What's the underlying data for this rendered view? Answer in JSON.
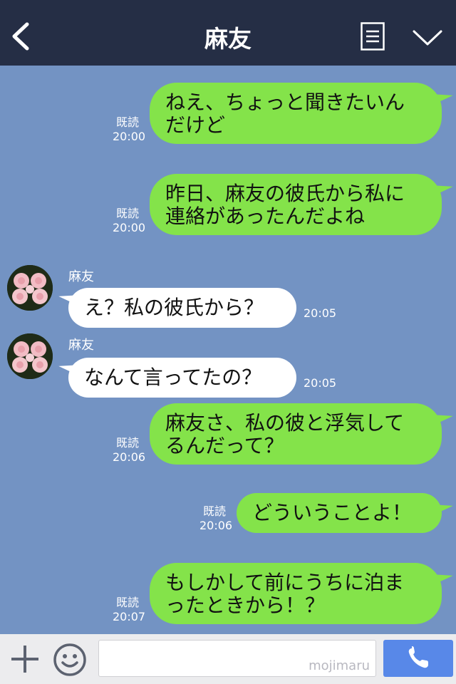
{
  "header": {
    "title": "麻友"
  },
  "chat": {
    "messages": [
      {
        "dir": "out",
        "text": "ねえ、ちょっと聞きたいん\nだけど",
        "read": "既読",
        "time": "20:00"
      },
      {
        "dir": "out",
        "text": "昨日、麻友の彼氏から私に\n連絡があったんだよね",
        "read": "既読",
        "time": "20:00"
      },
      {
        "dir": "in",
        "sender": "麻友",
        "text": "え？私の彼氏から？",
        "time": "20:05"
      },
      {
        "dir": "in",
        "sender": "麻友",
        "text": "なんて言ってたの？",
        "time": "20:05"
      },
      {
        "dir": "out",
        "text": "麻友さ、私の彼と浮気して\nるんだって？",
        "read": "既読",
        "time": "20:06"
      },
      {
        "dir": "out",
        "text": "どういうことよ！",
        "read": "既読",
        "time": "20:06"
      },
      {
        "dir": "out",
        "text": "もしかして前にうちに泊ま\nったときから！？",
        "read": "既読",
        "time": "20:07"
      }
    ]
  },
  "input_bar": {
    "watermark": "mojimaru"
  },
  "colors": {
    "header_bg": "#252e45",
    "chat_bg": "#7393c3",
    "outgoing_bubble": "#84e34a",
    "incoming_bubble": "#ffffff",
    "send_button": "#5888e8"
  },
  "icons": [
    "back-chevron-icon",
    "notes-icon",
    "chevron-down-icon",
    "plus-icon",
    "smiley-icon",
    "phone-icon",
    "rose-avatar"
  ]
}
